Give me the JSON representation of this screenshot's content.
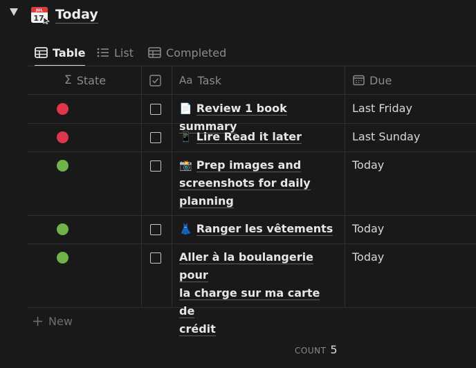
{
  "header": {
    "title": "Today",
    "icon": "calendar-icon",
    "calendar_month": "JUL",
    "calendar_day": "17"
  },
  "tabs": [
    {
      "label": "Table",
      "icon": "table-icon",
      "active": true
    },
    {
      "label": "List",
      "icon": "list-icon",
      "active": false
    },
    {
      "label": "Completed",
      "icon": "table-icon",
      "active": false
    }
  ],
  "columns": {
    "state": "State",
    "done": "",
    "task": "Task",
    "due": "Due"
  },
  "rows": [
    {
      "state_color": "#e0364b",
      "task": "Review 1 book summary",
      "emoji": "📄",
      "due": "Last Friday"
    },
    {
      "state_color": "#e0364b",
      "task": "Lire Read it later",
      "emoji": "📱",
      "due": "Last Sunday"
    },
    {
      "state_color": "#6fb24a",
      "task": "Prep images and screenshots for daily planning",
      "task_lines": [
        "Prep images and",
        "screenshots for daily",
        "planning"
      ],
      "emoji": "📸",
      "due": "Today"
    },
    {
      "state_color": "#6fb24a",
      "task": "Ranger les vêtements",
      "emoji": "👗",
      "due": "Today"
    },
    {
      "state_color": "#6fb24a",
      "task": "Aller à la boulangerie pour la charge sur ma carte de crédit",
      "task_lines": [
        "Aller à la boulangerie pour",
        "la charge sur ma carte de",
        "crédit"
      ],
      "emoji": "",
      "due": "Today"
    }
  ],
  "new_label": "New",
  "footer": {
    "count_label": "COUNT",
    "count_value": "5"
  }
}
